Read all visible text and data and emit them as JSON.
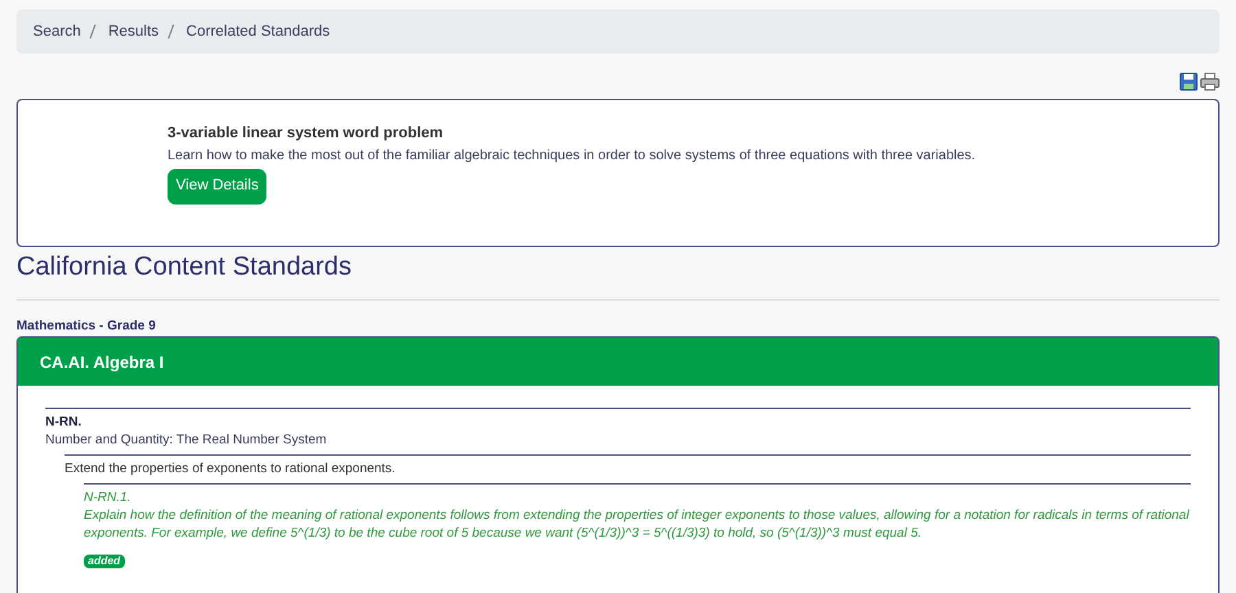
{
  "breadcrumbs": [
    {
      "label": "Search"
    },
    {
      "label": "Results"
    },
    {
      "label": "Correlated Standards"
    }
  ],
  "resource": {
    "title": "3-variable linear system word problem",
    "description": "Learn how to make the most out of the familiar algebraic techniques in order to solve systems of three equations with three variables.",
    "button": "View Details"
  },
  "section_title": "California Content Standards",
  "subject": "Mathematics - Grade 9",
  "course": "CA.AI. Algebra I",
  "standards": [
    {
      "code": "N-RN.",
      "text": "Number and Quantity: The Real Number System",
      "children": [
        {
          "text": "Extend the properties of exponents to rational exponents.",
          "children": [
            {
              "code": "N-RN.1.",
              "text": "Explain how the definition of the meaning of rational exponents follows from extending the properties of integer exponents to those values, allowing for a notation for radicals in terms of rational exponents. For example, we define 5^(1/3) to be the cube root of 5 because we want (5^(1/3))^3 = 5^((1/3)3) to hold, so (5^(1/3))^3 must equal 5.",
              "badge": "added",
              "matched": true
            }
          ]
        }
      ]
    }
  ]
}
